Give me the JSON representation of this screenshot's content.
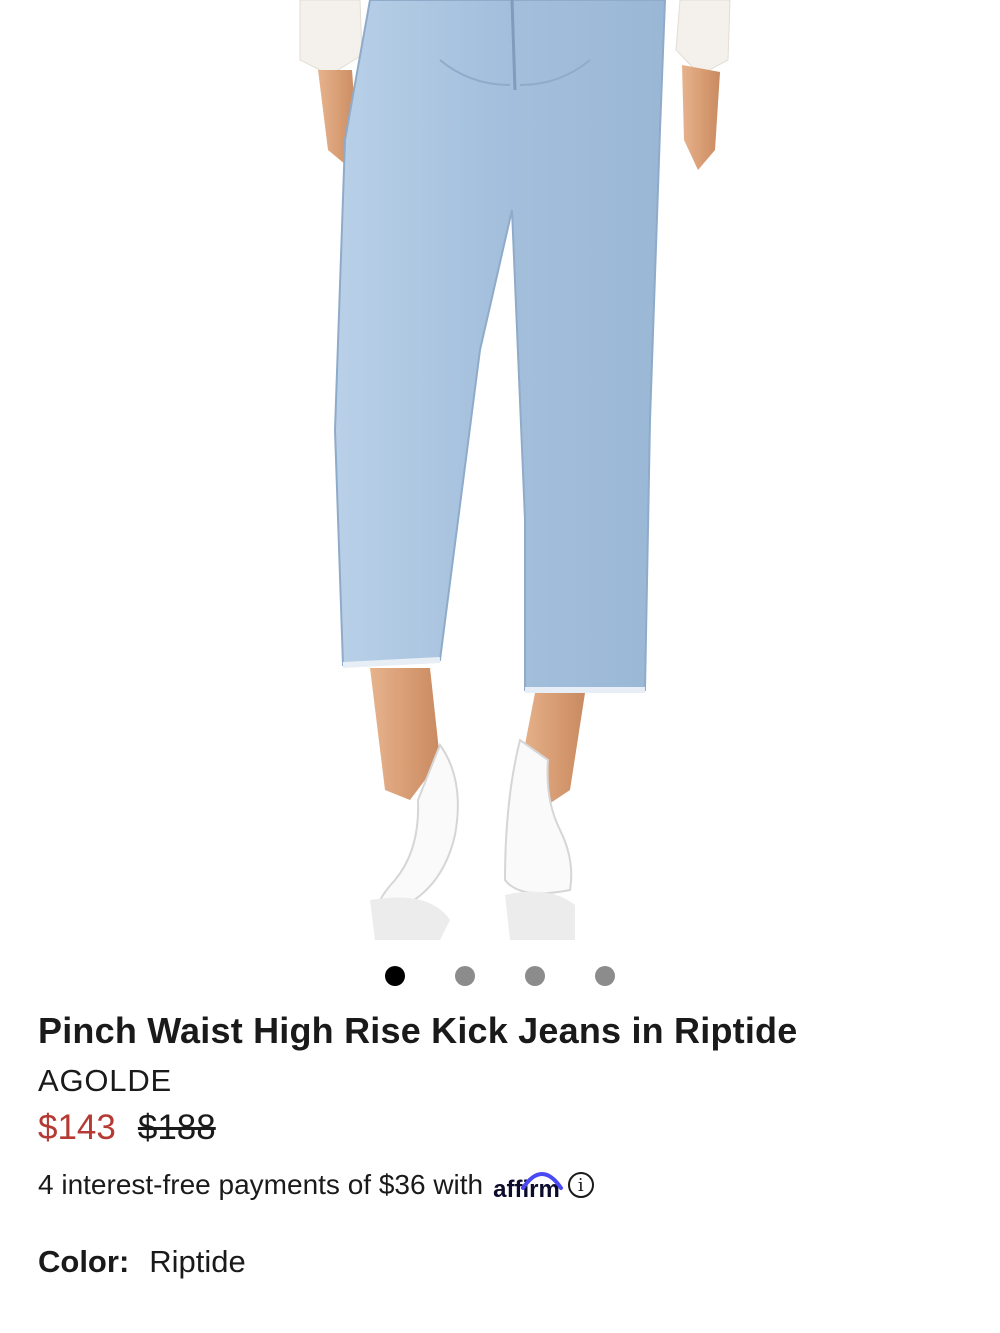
{
  "product": {
    "title": "Pinch Waist High Rise Kick Jeans in Riptide",
    "brand": "AGOLDE",
    "sale_price": "$143",
    "original_price": "$188",
    "image_description": "product-photo-jeans"
  },
  "carousel": {
    "slide_count": 4,
    "active_index": 0
  },
  "affirm": {
    "text": "4 interest-free payments of $36 with",
    "logo_text": "affirm",
    "info_glyph": "i"
  },
  "color": {
    "label": "Color",
    "separator": ":",
    "value": "Riptide"
  },
  "colors": {
    "sale": "#b43a33",
    "text": "#1a1a1a",
    "dot_active": "#000000",
    "dot_inactive": "#8c8c8c",
    "affirm_arc": "#4a4af4",
    "denim": "#a9c4e0"
  }
}
